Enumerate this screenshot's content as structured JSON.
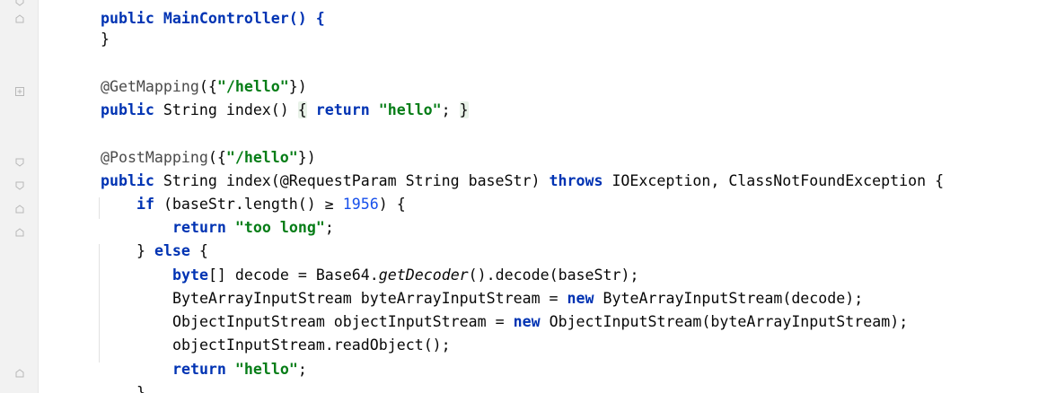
{
  "code": {
    "line_top_partial": "public MainController() {",
    "line_close_1": "}",
    "getmapping": {
      "annotation": "@GetMapping",
      "open": "({",
      "path": "\"/hello\"",
      "close": "})"
    },
    "get_method": {
      "kw_public": "public",
      "sig": " String index() ",
      "brace_open": "{",
      "kw_return": "return",
      "ret_value": "\"hello\"",
      "semi": ";",
      "brace_close": "}"
    },
    "postmapping": {
      "annotation": "@PostMapping",
      "open": "({",
      "path": "\"/hello\"",
      "close": "})"
    },
    "post_method": {
      "kw_public": "public",
      "sig": " String index(@RequestParam String baseStr) ",
      "kw_throws": "throws",
      "exceptions": " IOException, ClassNotFoundException {"
    },
    "if_line": {
      "kw_if": "if",
      "cond_start": " (baseStr.length() ",
      "op": "≥",
      "num": "1956",
      "cond_end": ") {"
    },
    "return_too_long": {
      "kw_return": "return",
      "value": "\"too long\"",
      "semi": ";"
    },
    "else_line": {
      "brace": "} ",
      "kw_else": "else",
      "open": " {"
    },
    "decode_line": {
      "kw_byte": "byte",
      "rest_a": "[] decode = Base64.",
      "method": "getDecoder",
      "rest_b": "().decode(baseStr);"
    },
    "bais_line": {
      "start": "ByteArrayInputStream byteArrayInputStream = ",
      "kw_new": "new",
      "end": " ByteArrayInputStream(decode);"
    },
    "ois_line": {
      "start": "ObjectInputStream objectInputStream = ",
      "kw_new": "new",
      "end": " ObjectInputStream(byteArrayInputStream);"
    },
    "read_line": "objectInputStream.readObject();",
    "return_hello": {
      "kw_return": "return",
      "value": "\"hello\"",
      "semi": ";"
    },
    "close_else": "}"
  }
}
